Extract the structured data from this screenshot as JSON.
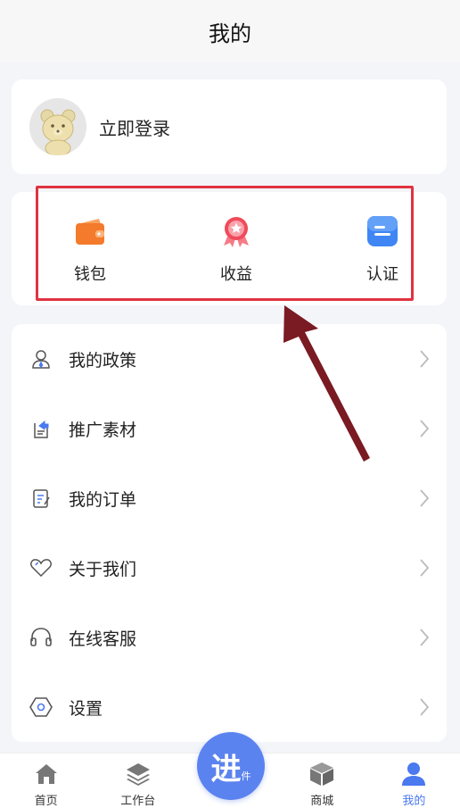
{
  "header": {
    "title": "我的"
  },
  "login": {
    "label": "立即登录",
    "avatar_icon": "bear-avatar-icon"
  },
  "quick_actions": [
    {
      "label": "钱包",
      "icon": "wallet-icon",
      "color": "#f47a2c"
    },
    {
      "label": "收益",
      "icon": "medal-icon",
      "color": "#ef4b5a"
    },
    {
      "label": "认证",
      "icon": "id-card-icon",
      "color": "#3f86f4"
    }
  ],
  "menu": [
    {
      "label": "我的政策",
      "icon": "user-policy-icon"
    },
    {
      "label": "推广素材",
      "icon": "share-material-icon"
    },
    {
      "label": "我的订单",
      "icon": "order-icon"
    },
    {
      "label": "关于我们",
      "icon": "heart-icon"
    },
    {
      "label": "在线客服",
      "icon": "headset-icon"
    },
    {
      "label": "设置",
      "icon": "settings-icon"
    }
  ],
  "tabbar": {
    "items": [
      {
        "label": "首页",
        "icon": "home-icon"
      },
      {
        "label": "工作台",
        "icon": "layers-icon"
      },
      {
        "label": "商城",
        "icon": "box-icon"
      },
      {
        "label": "我的",
        "icon": "person-icon",
        "active": true
      }
    ],
    "center": {
      "main": "进",
      "sub": "件"
    }
  },
  "colors": {
    "accent": "#4a79f0",
    "highlight": "#e03340",
    "arrow": "#7a1a22"
  }
}
